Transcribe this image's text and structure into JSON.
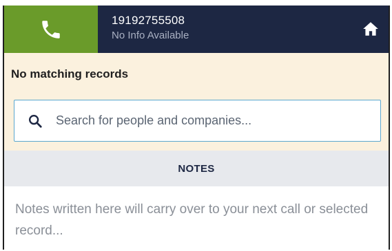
{
  "header": {
    "caller_number": "19192755508",
    "caller_info": "No Info Available",
    "call_icon": "phone-icon",
    "home_icon": "home-icon",
    "colors": {
      "header_bg": "#1d2743",
      "call_bg": "#6a9b2a"
    }
  },
  "match": {
    "title": "No matching records",
    "background": "#fbf1de"
  },
  "search": {
    "icon": "search-icon",
    "value": "",
    "placeholder": "Search for people and companies..."
  },
  "notes": {
    "header": "NOTES",
    "value": "",
    "placeholder": "Notes written here will carry over to your next call or selected record..."
  }
}
